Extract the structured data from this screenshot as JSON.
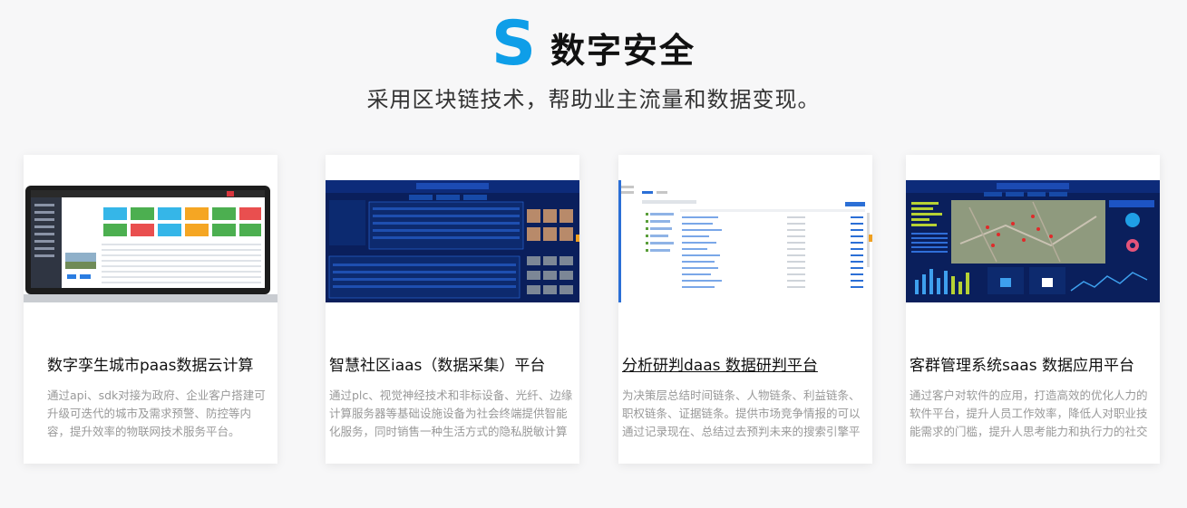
{
  "header": {
    "logo_letter": "S",
    "title": "数字安全",
    "subtitle": "采用区块链技术，帮助业主流量和数据变现。"
  },
  "cards": [
    {
      "title": "数字孪生城市paas数据云计算",
      "description": "通过api、sdk对接为政府、企业客户搭建可升级可迭代的城市及需求预警、防控等内容，提升效率的物联网技术服务平台。"
    },
    {
      "title": "智慧社区iaas（数据采集）平台",
      "description": "通过plc、视觉神经技术和非标设备、光纤、边缘计算服务器等基础设施设备为社会终端提供智能化服务，同时销售一种生活方式的隐私脱敏计算平台。"
    },
    {
      "title": "分析研判daas 数据研判平台",
      "description": "为决策层总结时间链条、人物链条、利益链条、职权链条、证据链条。提供市场竞争情报的可以通过记录现在、总结过去预判未来的搜索引擎平台。"
    },
    {
      "title": "客群管理系统saas 数据应用平台",
      "description": "通过客户对软件的应用，打造高效的优化人力的软件平台，提升人员工作效率，降低人对职业技能需求的门槛，提升人思考能力和执行力的社交电商平台。"
    }
  ],
  "colors": {
    "accent": "#0e9ee8",
    "dashboard_dark": "#0a1f5c",
    "background": "#f7f7f8"
  }
}
